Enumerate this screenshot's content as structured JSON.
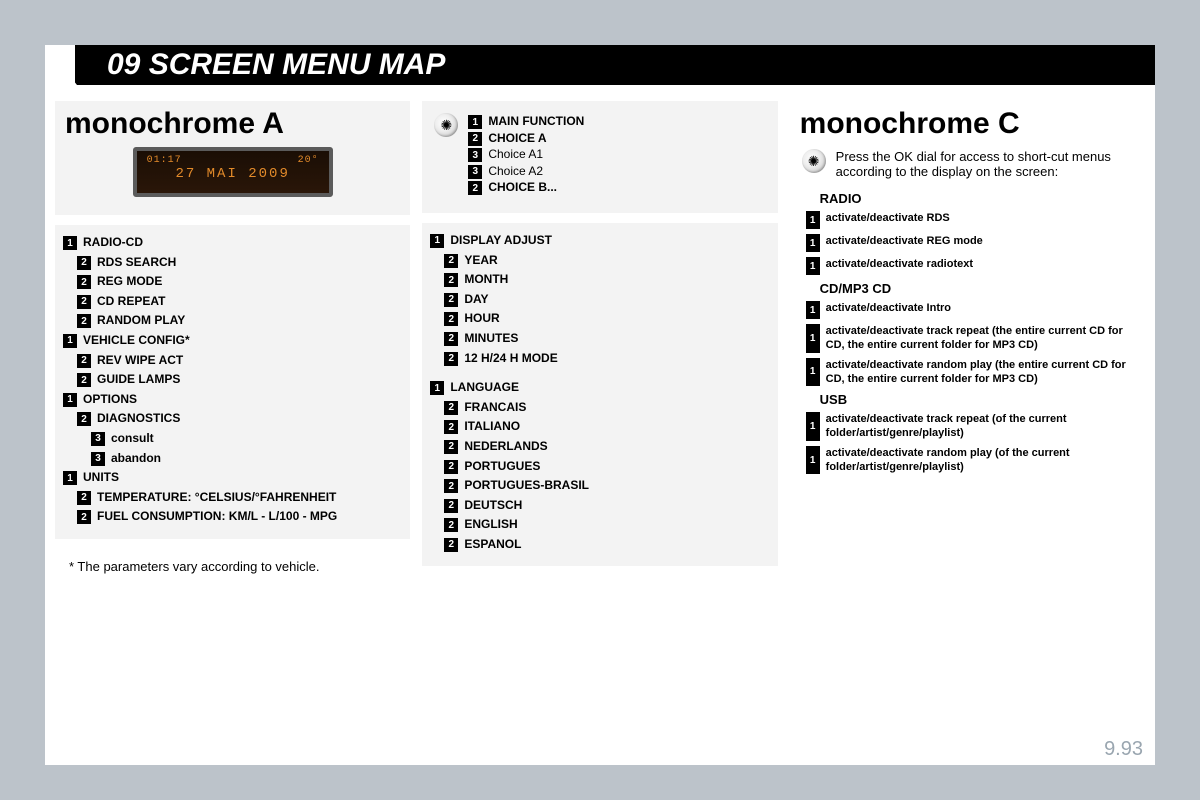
{
  "title": "09 SCREEN MENU MAP",
  "pagenum": "9.93",
  "footnote": "* The parameters vary according to vehicle.",
  "lcd": {
    "time": "01:17",
    "temp": "20°",
    "date": "27 MAI 2009"
  },
  "legend": {
    "main": "MAIN FUNCTION",
    "choiceA": "CHOICE A",
    "choiceA1": "Choice A1",
    "choiceA2": "Choice A2",
    "choiceB": "CHOICE B..."
  },
  "colA": {
    "heading": "monochrome A",
    "items": [
      {
        "level": 1,
        "num": "1",
        "label": "RADIO-CD"
      },
      {
        "level": 2,
        "num": "2",
        "label": "RDS SEARCH"
      },
      {
        "level": 2,
        "num": "2",
        "label": "REG MODE"
      },
      {
        "level": 2,
        "num": "2",
        "label": "CD REPEAT"
      },
      {
        "level": 2,
        "num": "2",
        "label": "RANDOM PLAY"
      },
      {
        "level": 1,
        "num": "1",
        "label": "VEHICLE CONFIG*"
      },
      {
        "level": 2,
        "num": "2",
        "label": "REV WIPE ACT"
      },
      {
        "level": 2,
        "num": "2",
        "label": "GUIDE LAMPS"
      },
      {
        "level": 1,
        "num": "1",
        "label": "OPTIONS"
      },
      {
        "level": 2,
        "num": "2",
        "label": "DIAGNOSTICS"
      },
      {
        "level": 3,
        "num": "3",
        "label": "consult"
      },
      {
        "level": 3,
        "num": "3",
        "label": "abandon"
      },
      {
        "level": 1,
        "num": "1",
        "label": "UNITS"
      },
      {
        "level": 2,
        "num": "2",
        "label": "TEMPERATURE: °CELSIUS/°FAHRENHEIT"
      },
      {
        "level": 2,
        "num": "2",
        "label": "FUEL CONSUMPTION: KM/L - L/100 - MPG"
      }
    ]
  },
  "colB": {
    "groups": [
      {
        "items": [
          {
            "level": 1,
            "num": "1",
            "label": "DISPLAY ADJUST"
          },
          {
            "level": 2,
            "num": "2",
            "label": "YEAR"
          },
          {
            "level": 2,
            "num": "2",
            "label": "MONTH"
          },
          {
            "level": 2,
            "num": "2",
            "label": "DAY"
          },
          {
            "level": 2,
            "num": "2",
            "label": "HOUR"
          },
          {
            "level": 2,
            "num": "2",
            "label": "MINUTES"
          },
          {
            "level": 2,
            "num": "2",
            "label": "12 H/24 H MODE"
          }
        ]
      },
      {
        "items": [
          {
            "level": 1,
            "num": "1",
            "label": "LANGUAGE"
          },
          {
            "level": 2,
            "num": "2",
            "label": "FRANCAIS"
          },
          {
            "level": 2,
            "num": "2",
            "label": "ITALIANO"
          },
          {
            "level": 2,
            "num": "2",
            "label": "NEDERLANDS"
          },
          {
            "level": 2,
            "num": "2",
            "label": "PORTUGUES"
          },
          {
            "level": 2,
            "num": "2",
            "label": "PORTUGUES-BRASIL"
          },
          {
            "level": 2,
            "num": "2",
            "label": "DEUTSCH"
          },
          {
            "level": 2,
            "num": "2",
            "label": "ENGLISH"
          },
          {
            "level": 2,
            "num": "2",
            "label": "ESPANOL"
          }
        ]
      }
    ]
  },
  "colC": {
    "heading": "monochrome C",
    "note": "Press the OK dial for access to short-cut menus according to the display on the screen:",
    "sections": [
      {
        "title": "RADIO",
        "items": [
          "activate/deactivate RDS",
          "activate/deactivate REG mode",
          "activate/deactivate radiotext"
        ]
      },
      {
        "title": "CD/MP3 CD",
        "items": [
          "activate/deactivate Intro",
          "activate/deactivate track repeat (the entire current CD for CD, the entire current folder for MP3 CD)",
          "activate/deactivate random play (the entire current CD for CD, the entire current folder for MP3 CD)"
        ]
      },
      {
        "title": "USB",
        "items": [
          "activate/deactivate track repeat (of the current folder/artist/genre/playlist)",
          "activate/deactivate random play (of the current folder/artist/genre/playlist)"
        ]
      }
    ]
  }
}
